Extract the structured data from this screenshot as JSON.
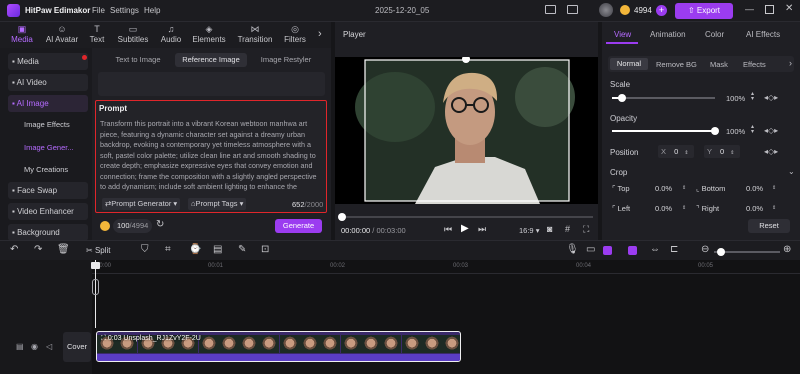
{
  "app": {
    "title": "HitPaw Edimakor",
    "menu": [
      "File",
      "Settings",
      "Help"
    ],
    "project_name": "2025-12-20_05",
    "credits": "4994",
    "export_label": "Export"
  },
  "colors": {
    "accent": "#9b3cf0",
    "highlight": "#e0262b",
    "brand_text": "#b56bff"
  },
  "toolbar": {
    "items": [
      {
        "label": "Media",
        "icon": "media-icon"
      },
      {
        "label": "AI Avatar",
        "icon": "ai-avatar-icon"
      },
      {
        "label": "Text",
        "icon": "text-icon"
      },
      {
        "label": "Subtitles",
        "icon": "subtitles-icon"
      },
      {
        "label": "Audio",
        "icon": "audio-icon"
      },
      {
        "label": "Elements",
        "icon": "elements-icon"
      },
      {
        "label": "Transition",
        "icon": "transition-icon"
      },
      {
        "label": "Filters",
        "icon": "filters-icon"
      }
    ]
  },
  "sidebar": {
    "items": [
      {
        "label": "Media"
      },
      {
        "label": "AI Video"
      },
      {
        "label": "AI Image"
      },
      {
        "label": "Face Swap"
      },
      {
        "label": "Video Enhancer"
      },
      {
        "label": "Background"
      }
    ],
    "subitems": [
      "Image Effects",
      "Image Gener...",
      "My Creations"
    ]
  },
  "ai_image": {
    "tabs": [
      "Text to Image",
      "Reference Image",
      "Image Restyler"
    ],
    "prompt_label": "Prompt",
    "prompt_text": "Transform this portrait into a vibrant Korean webtoon manhwa art piece, featuring a dynamic character set against a dreamy urban backdrop, evoking a contemporary yet timeless atmosphere with a soft, pastel color palette; utilize clean line art and smooth shading to create depth; emphasize expressive eyes that convey emotion and connection; frame the composition with a slightly angled perspective to add dynamism; include soft ambient lighting to enhance the ethereal quality; capture a",
    "prompt_generator": "Prompt Generator",
    "prompt_tags": "Prompt Tags",
    "char_count": "652",
    "char_max": "/2000",
    "credits_used": "100",
    "credits_total": "/4994",
    "generate_label": "Generate"
  },
  "player": {
    "title": "Player",
    "time_current": "00:00:00",
    "time_total": "/ 00:03:00",
    "aspect": "16:9"
  },
  "properties": {
    "tabs": [
      "View",
      "Animation",
      "Color",
      "AI Effects"
    ],
    "subtabs": [
      "Normal",
      "Remove BG",
      "Mask",
      "Effects"
    ],
    "scale_label": "Scale",
    "scale_value": "100%",
    "scale_level": 0.1,
    "opacity_label": "Opacity",
    "opacity_value": "100%",
    "opacity_level": 1.0,
    "position_label": "Position",
    "pos_x_label": "X",
    "pos_x": "0",
    "pos_y_label": "Y",
    "pos_y": "0",
    "crop_label": "Crop",
    "crop": [
      {
        "label": "Top",
        "value": "0.0%"
      },
      {
        "label": "Bottom",
        "value": "0.0%"
      },
      {
        "label": "Left",
        "value": "0.0%"
      },
      {
        "label": "Right",
        "value": "0.0%"
      }
    ],
    "reset_label": "Reset"
  },
  "timeline": {
    "split_label": "Split",
    "ticks": [
      "00:00",
      "00:01",
      "00:02",
      "00:03",
      "00:04",
      "00:05"
    ],
    "cover_label": "Cover",
    "clip_label": "0:03  Unsplash_RJ1ZvY2F-2U"
  }
}
